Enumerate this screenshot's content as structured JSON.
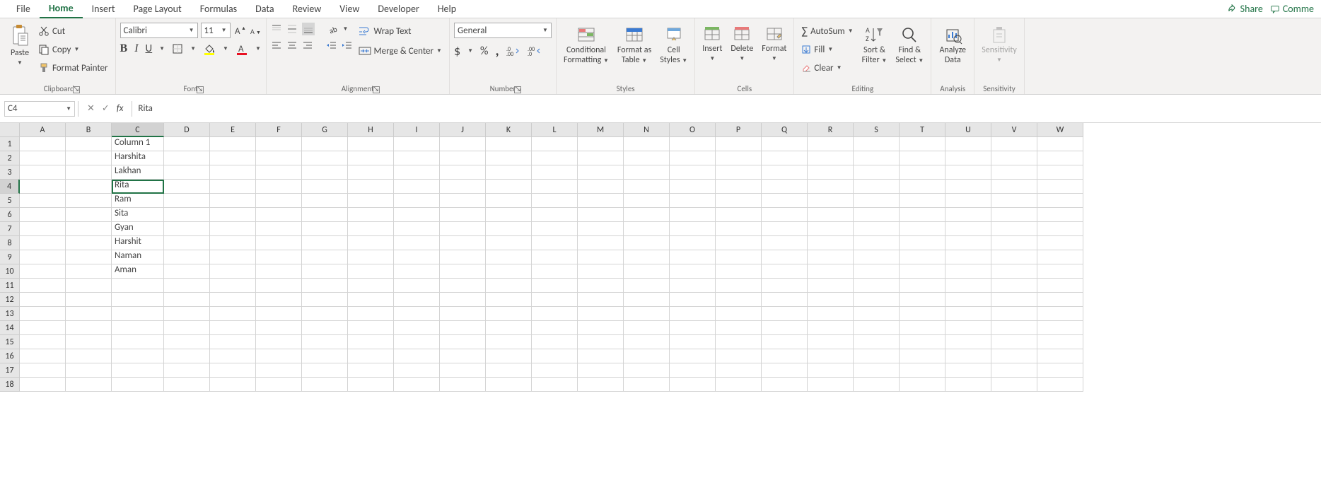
{
  "tabs": {
    "File": "File",
    "Home": "Home",
    "Insert": "Insert",
    "PageLayout": "Page Layout",
    "Formulas": "Formulas",
    "Data": "Data",
    "Review": "Review",
    "View": "View",
    "Developer": "Developer",
    "Help": "Help"
  },
  "rtabs": {
    "Share": "Share",
    "Comments": "Comme"
  },
  "clipboard": {
    "Paste": "Paste",
    "Cut": "Cut",
    "Copy": "Copy",
    "FormatPainter": "Format Painter",
    "Label": "Clipboard"
  },
  "font": {
    "Name": "Calibri",
    "Size": "11",
    "Label": "Font"
  },
  "alignment": {
    "WrapText": "Wrap Text",
    "MergeCenter": "Merge & Center",
    "Label": "Alignment"
  },
  "number": {
    "Format": "General",
    "Label": "Number"
  },
  "styles": {
    "Conditional": "Conditional",
    "Formatting": "Formatting",
    "FormatAs": "Format as",
    "Table": "Table",
    "Cell": "Cell",
    "Styles": "Styles",
    "Label": "Styles"
  },
  "cells": {
    "Insert": "Insert",
    "Delete": "Delete",
    "Format": "Format",
    "Label": "Cells"
  },
  "editing": {
    "AutoSum": "AutoSum",
    "Fill": "Fill",
    "Clear": "Clear",
    "SortFilter1": "Sort &",
    "SortFilter2": "Filter",
    "FindSelect1": "Find &",
    "FindSelect2": "Select",
    "Label": "Editing"
  },
  "analysis": {
    "Analyze": "Analyze",
    "Data": "Data",
    "Label": "Analysis"
  },
  "sensitivity": {
    "Sensitivity": "Sensitivity",
    "Label": "Sensitivity"
  },
  "formula": {
    "nameBox": "C4",
    "value": "Rita"
  },
  "grid": {
    "activeCell": {
      "col": "C",
      "row": 4
    },
    "columns": [
      "A",
      "B",
      "C",
      "D",
      "E",
      "F",
      "G",
      "H",
      "I",
      "J",
      "K",
      "L",
      "M",
      "N",
      "O",
      "P",
      "Q",
      "R",
      "S",
      "T",
      "U",
      "V",
      "W"
    ],
    "rows": [
      1,
      2,
      3,
      4,
      5,
      6,
      7,
      8,
      9,
      10,
      11,
      12,
      13,
      14,
      15,
      16,
      17,
      18
    ],
    "data": {
      "C1": "Column 1",
      "C2": "Harshita",
      "C3": "Lakhan",
      "C4": "Rita",
      "C5": "Ram",
      "C6": "Sita",
      "C7": "Gyan",
      "C8": "Harshit",
      "C9": "Naman",
      "C10": "Aman"
    }
  }
}
